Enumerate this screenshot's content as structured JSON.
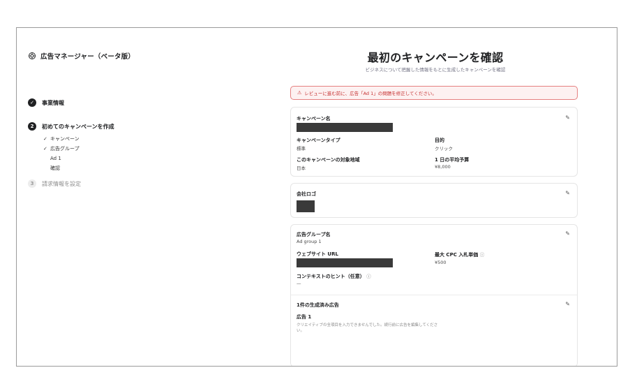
{
  "app": {
    "title": "広告マネージャー（ベータ版）"
  },
  "steps": {
    "step1": {
      "num": "✓",
      "label": "事業情報"
    },
    "step2": {
      "num": "2",
      "label": "初めてのキャンペーンを作成"
    },
    "sub": [
      {
        "check": "✓",
        "label": "キャンペーン"
      },
      {
        "check": "✓",
        "label": "広告グループ"
      },
      {
        "check": "",
        "label": "Ad 1"
      },
      {
        "check": "",
        "label": "確認"
      }
    ],
    "step3": {
      "num": "3",
      "label": "請求情報を設定"
    }
  },
  "main": {
    "title": "最初のキャンペーンを確認",
    "subtitle": "ビジネスについて把握した情報をもとに生成したキャンペーンを確認",
    "alert": {
      "icon": "warning-icon",
      "text": "レビューに進む前に、広告「Ad 1」の問題を修正してください。"
    }
  },
  "campaign": {
    "name_label": "キャンペーン名",
    "type_label": "キャンペーンタイプ",
    "type_value": "標準",
    "goal_label": "目的",
    "goal_value": "クリック",
    "region_label": "このキャンペーンの対象地域",
    "region_value": "日本",
    "budget_label": "1 日の平均予算",
    "budget_value": "¥8,000"
  },
  "company": {
    "logo_label": "会社ロゴ"
  },
  "adgroup": {
    "name_label": "広告グループ名",
    "name_value": "Ad group 1",
    "website_label": "ウェブサイト URL",
    "cpc_label": "最大 CPC 入札単価",
    "cpc_value": "¥500",
    "context_label": "コンテキストのヒント（任意）",
    "context_value": "—",
    "generated_label": "1件の生成済み広告",
    "ad_label": "広告 1",
    "ad_error": "クリエイティブの全項目を入力できませんでした。続行前に広告を編集してください。"
  },
  "colors": {
    "accent_error": "#c53030",
    "alert_bg": "#fdf1f1",
    "dark": "#202123"
  }
}
